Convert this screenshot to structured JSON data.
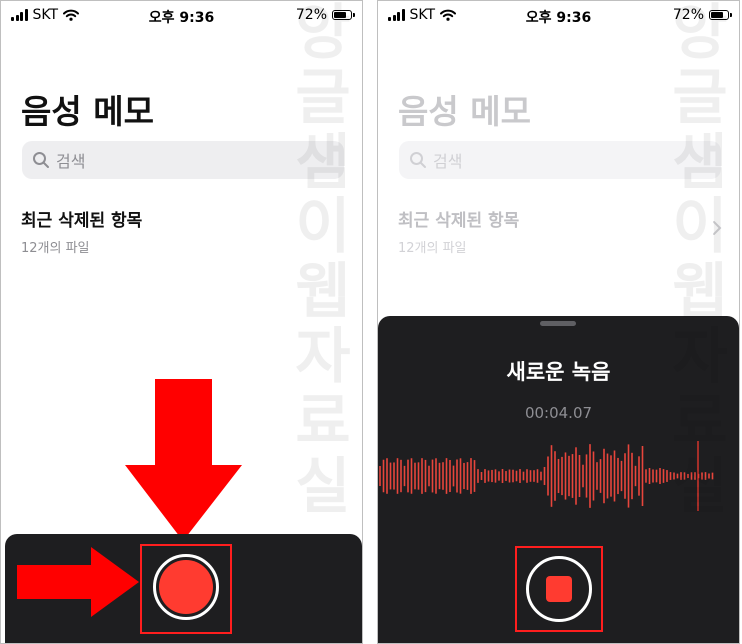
{
  "status_bar": {
    "carrier": "SKT",
    "time": "오후 9:36",
    "battery": "72%",
    "battery_level": 0.72
  },
  "watermark": [
    "앙",
    "글",
    "샘",
    "이",
    "웹",
    "자",
    "료",
    "실"
  ],
  "left_screen": {
    "title": "음성 메모",
    "search_placeholder": "검색",
    "list_item": {
      "title": "최근 삭제된 항목",
      "subtitle": "12개의 파일"
    }
  },
  "right_screen": {
    "title": "음성 메모",
    "search_placeholder": "검색",
    "list_item": {
      "title": "최근 삭제된 항목",
      "subtitle": "12개의 파일"
    },
    "recording": {
      "title": "새로운 녹음",
      "elapsed": "00:04.07"
    }
  },
  "colors": {
    "record_red": "#ff3b30",
    "annotation_red": "#ff0000",
    "sheet_bg": "#1e1e20"
  },
  "icons": [
    "signal-icon",
    "wifi-icon",
    "battery-icon",
    "search-icon",
    "chevron-right-icon",
    "record-icon",
    "stop-icon",
    "arrow-down-icon",
    "arrow-right-icon"
  ]
}
